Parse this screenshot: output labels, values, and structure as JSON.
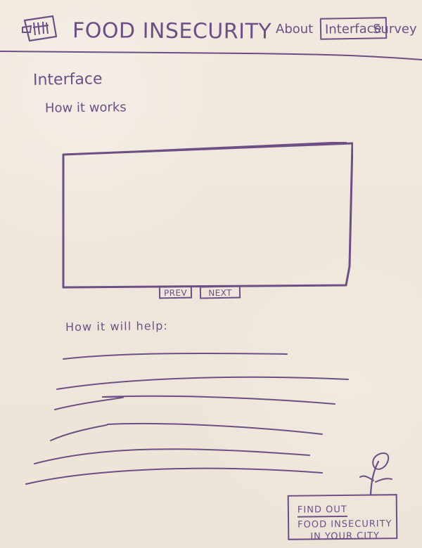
{
  "header": {
    "brand": "FOOD INSECURITY",
    "nav": {
      "about": "About",
      "interface": "Interface",
      "survey": "Survey"
    }
  },
  "main": {
    "title": "Interface",
    "subtitle": "How it works",
    "controls": {
      "prev": "PREV",
      "next": "NEXT"
    },
    "help_title": "How it will help:"
  },
  "cta": {
    "line1": "FIND OUT",
    "line2": "FOOD INSECURITY",
    "line3": "IN YOUR CITY"
  },
  "colors": {
    "ink": "#6d4f86",
    "paper": "#efe7dc"
  }
}
